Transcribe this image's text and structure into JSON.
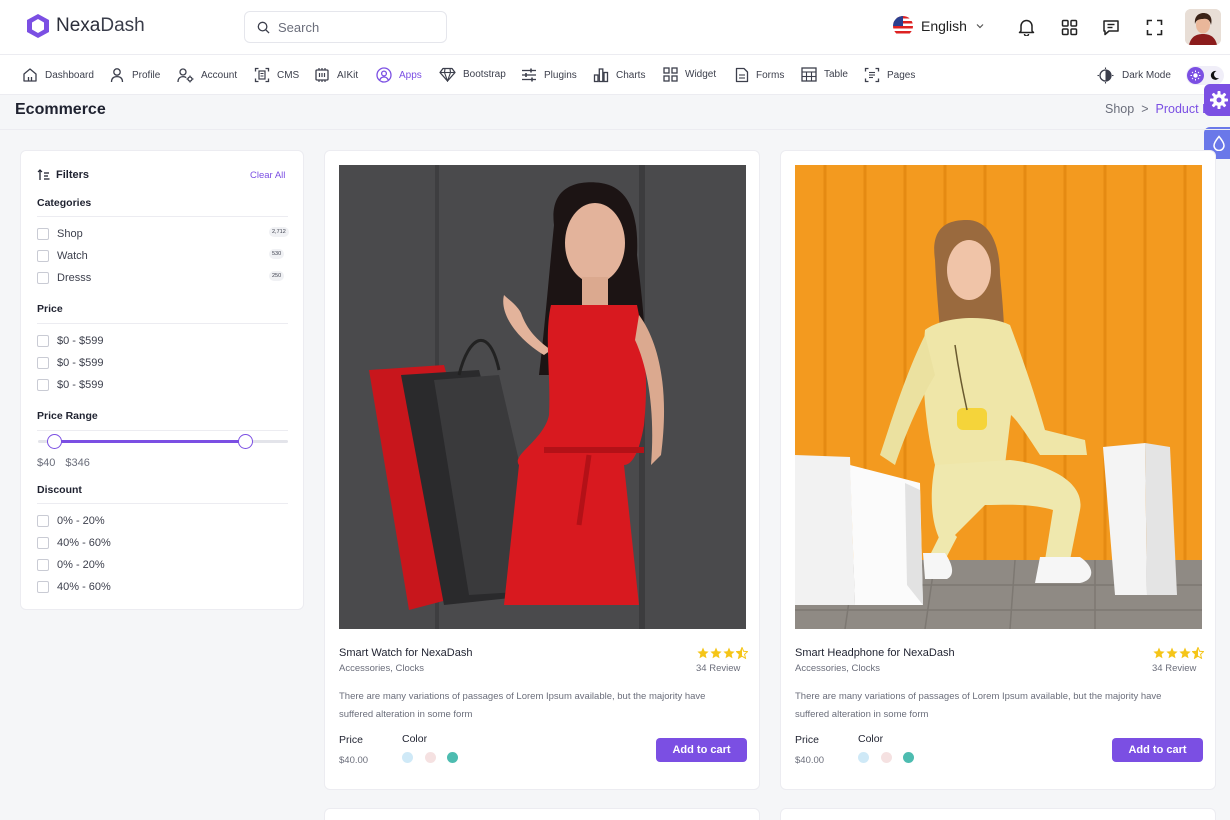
{
  "header": {
    "brand_first": "Nexa",
    "brand_second": "Dash",
    "search_placeholder": "Search",
    "language": "English"
  },
  "nav": {
    "items": [
      {
        "label": "Dashboard",
        "icon": "home-icon"
      },
      {
        "label": "Profile",
        "icon": "user-icon"
      },
      {
        "label": "Account",
        "icon": "user-settings-icon"
      },
      {
        "label": "CMS",
        "icon": "document-scan-icon"
      },
      {
        "label": "AIKit",
        "icon": "ai-kit-icon"
      },
      {
        "label": "Apps",
        "icon": "user-circle-icon"
      },
      {
        "label": "Bootstrap",
        "icon": "diamond-icon"
      },
      {
        "label": "Plugins",
        "icon": "sliders-icon"
      },
      {
        "label": "Charts",
        "icon": "bar-chart-icon"
      },
      {
        "label": "Widget",
        "icon": "grid-icon"
      },
      {
        "label": "Forms",
        "icon": "form-icon"
      },
      {
        "label": "Table",
        "icon": "table-icon"
      },
      {
        "label": "Pages",
        "icon": "pages-icon"
      }
    ],
    "active": "Apps",
    "dark_mode_label": "Dark Mode"
  },
  "page": {
    "title": "Ecommerce",
    "breadcrumb": [
      "Shop",
      "Product D"
    ]
  },
  "filters": {
    "title": "Filters",
    "clear_label": "Clear All",
    "categories_title": "Categories",
    "categories": [
      {
        "label": "Shop",
        "count": "2,712"
      },
      {
        "label": "Watch",
        "count": "530"
      },
      {
        "label": "Dresss",
        "count": "250"
      }
    ],
    "price_title": "Price",
    "prices": [
      "$0 - $599",
      "$0 - $599",
      "$0 - $599"
    ],
    "range_title": "Price Range",
    "range_min": "$40",
    "range_max": "$346",
    "discount_title": "Discount",
    "discounts": [
      "0% - 20%",
      "40% - 60%",
      "0% - 20%",
      "40% - 60%"
    ]
  },
  "products": [
    {
      "name": "Smart Watch for NexaDash",
      "category": "Accessories, Clocks",
      "rating": 3.5,
      "reviews": "34 Review",
      "description": "There are many variations of passages of Lorem Ipsum available, but the majority have suffered alteration in some form",
      "price_label": "Price",
      "price": "$40.00",
      "color_label": "Color",
      "colors": [
        "#cfe9f7",
        "#f5e1e1",
        "#4dbcb0"
      ],
      "cart_label": "Add to cart"
    },
    {
      "name": "Smart Headphone for NexaDash",
      "category": "Accessories, Clocks",
      "rating": 3.5,
      "reviews": "34 Review",
      "description": "There are many variations of passages of Lorem Ipsum available, but the majority have suffered alteration in some form",
      "price_label": "Price",
      "price": "$40.00",
      "color_label": "Color",
      "colors": [
        "#cfe9f7",
        "#f5e1e1",
        "#4dbcb0"
      ],
      "cart_label": "Add to cart"
    }
  ],
  "colors": {
    "accent": "#7b4fe3",
    "star": "#f5c518"
  }
}
